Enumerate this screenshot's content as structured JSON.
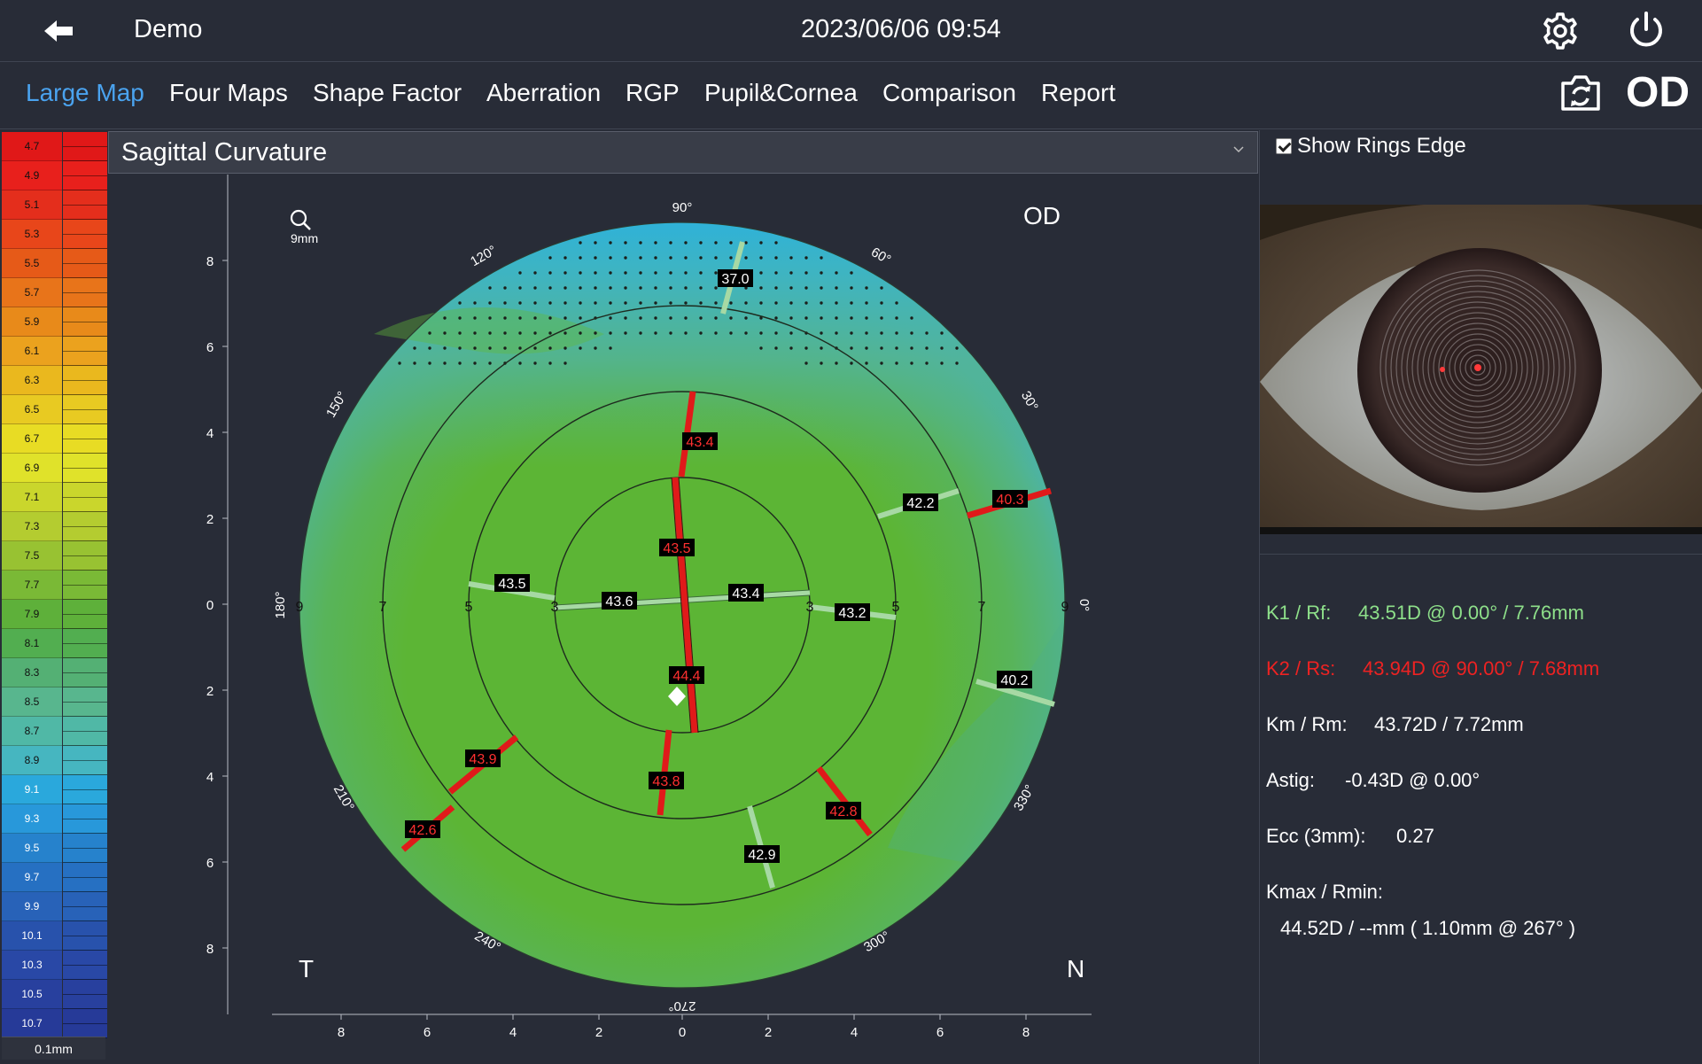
{
  "header": {
    "patient_name": "Demo",
    "datetime": "2023/06/06 09:54",
    "icons": {
      "back": "back-arrow-icon",
      "settings": "gear-icon",
      "power": "power-icon"
    }
  },
  "tabs": {
    "items": [
      {
        "label": "Large Map",
        "active": true
      },
      {
        "label": "Four Maps",
        "active": false
      },
      {
        "label": "Shape Factor",
        "active": false
      },
      {
        "label": "Aberration",
        "active": false
      },
      {
        "label": "RGP",
        "active": false
      },
      {
        "label": "Pupil&Cornea",
        "active": false
      },
      {
        "label": "Comparison",
        "active": false
      },
      {
        "label": "Report",
        "active": false
      }
    ],
    "camera_icon": "camera-rotate-icon",
    "eye_side": "OD"
  },
  "scale": {
    "labels": [
      "4.7",
      "4.9",
      "5.1",
      "5.3",
      "5.5",
      "5.7",
      "5.9",
      "6.1",
      "6.3",
      "6.5",
      "6.7",
      "6.9",
      "7.1",
      "7.3",
      "7.5",
      "7.7",
      "7.9",
      "8.1",
      "8.3",
      "8.5",
      "8.7",
      "8.9",
      "9.1",
      "9.3",
      "9.5",
      "9.7",
      "9.9",
      "10.1",
      "10.3",
      "10.5",
      "10.7"
    ],
    "colors": [
      "#e01818",
      "#e8201c",
      "#e42e1c",
      "#e8461a",
      "#e65a18",
      "#e8741a",
      "#e88a1a",
      "#eba21e",
      "#eab81e",
      "#e8ca22",
      "#e8dc24",
      "#e0e22a",
      "#cad62c",
      "#b4cc30",
      "#98c232",
      "#7ab936",
      "#5eb03a",
      "#52ae50",
      "#54b074",
      "#58b68e",
      "#50b8a6",
      "#46b6c0",
      "#2aa8dc",
      "#2898da",
      "#2682cc",
      "#2670c2",
      "#2862b8",
      "#2852ac",
      "#2948a6",
      "#28409e",
      "#263a98"
    ],
    "step": "0.1mm"
  },
  "map": {
    "type_label": "Sagittal Curvature",
    "zoom_label": "9mm",
    "eye_label": "OD",
    "temporal_label": "T",
    "nasal_label": "N",
    "angle_labels": [
      "90°",
      "60°",
      "30°",
      "0°",
      "330°",
      "300°",
      "270°",
      "240°",
      "210°",
      "180°",
      "150°",
      "120°"
    ],
    "ring_labels": [
      "3",
      "5",
      "7",
      "9"
    ],
    "x_axis_ticks": [
      "8",
      "6",
      "4",
      "2",
      "0",
      "2",
      "4",
      "6",
      "8"
    ],
    "y_axis_ticks": [
      "8",
      "6",
      "4",
      "2",
      "0",
      "2",
      "4",
      "6",
      "8"
    ],
    "values_flat": [
      "43.6",
      "43.4",
      "43.5",
      "43.2",
      "42.2",
      "40.3",
      "40.2",
      "37.0",
      "43.4",
      "43.5",
      "44.4",
      "43.8",
      "43.9",
      "42.6",
      "42.8",
      "42.9"
    ],
    "steep_values": [
      "43.4",
      "43.5",
      "44.4",
      "43.8",
      "43.9",
      "42.6",
      "42.8",
      "40.3"
    ],
    "colors": {
      "flat_axis": "#a7d9a4",
      "steep_axis": "#e01a1a",
      "background": "#5cb535"
    }
  },
  "right": {
    "show_rings_edge": {
      "label": "Show Rings Edge",
      "checked": true
    },
    "k1": {
      "label": "K1 / Rf:",
      "value": "43.51D @ 0.00° / 7.76mm"
    },
    "k2": {
      "label": "K2 / Rs:",
      "value": "43.94D @ 90.00° / 7.68mm"
    },
    "km": {
      "label": "Km / Rm:",
      "value": "43.72D / 7.72mm"
    },
    "astig": {
      "label": "Astig:",
      "value": "-0.43D @ 0.00°"
    },
    "ecc": {
      "label": "Ecc (3mm):",
      "value": "0.27"
    },
    "kmax": {
      "label": "Kmax / Rmin:",
      "value": "44.52D / --mm ( 1.10mm @ 267° )"
    }
  }
}
